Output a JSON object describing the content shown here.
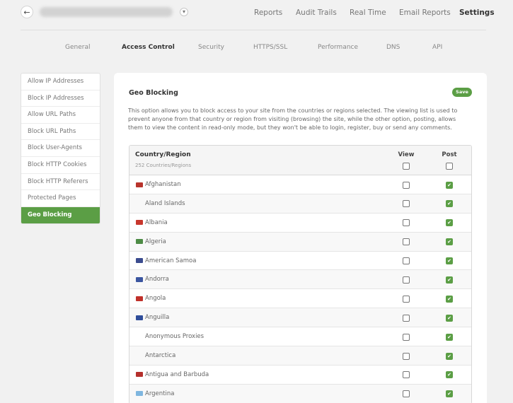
{
  "header": {
    "back_icon": "arrow-left-icon",
    "nav": [
      "Reports",
      "Audit Trails",
      "Real Time",
      "Email Reports",
      "Settings"
    ],
    "active_nav": "Settings"
  },
  "subnav": {
    "tabs": [
      "General",
      "Access Control",
      "Security",
      "HTTPS/SSL",
      "Performance",
      "DNS",
      "API"
    ],
    "active": "Access Control"
  },
  "sidebar": {
    "items": [
      "Allow IP Addresses",
      "Block IP Addresses",
      "Allow URL Paths",
      "Block URL Paths",
      "Block User-Agents",
      "Block HTTP Cookies",
      "Block HTTP Referers",
      "Protected Pages",
      "Geo Blocking"
    ],
    "active": "Geo Blocking"
  },
  "main": {
    "title": "Geo Blocking",
    "save_label": "Save",
    "description": "This option allows you to block access to your site from the countries or regions selected. The viewing list is used to prevent anyone from that country or region from visiting (browsing) the site, while the other option, posting, allows them to view the content in read-only mode, but they won't be able to login, register, buy or send any comments.",
    "table": {
      "column_country": "Country/Region",
      "count_label": "252 Countries/Regions",
      "column_view": "View",
      "column_post": "Post",
      "rows": [
        {
          "name": "Afghanistan",
          "flag": "#b8342c",
          "view": false,
          "post": true
        },
        {
          "name": "Aland Islands",
          "flag": "",
          "view": false,
          "post": true
        },
        {
          "name": "Albania",
          "flag": "#c8372d",
          "view": false,
          "post": true
        },
        {
          "name": "Algeria",
          "flag": "#4d8b45",
          "view": false,
          "post": true
        },
        {
          "name": "American Samoa",
          "flag": "#3b4c8f",
          "view": false,
          "post": true
        },
        {
          "name": "Andorra",
          "flag": "#3a55a0",
          "view": false,
          "post": true
        },
        {
          "name": "Angola",
          "flag": "#c0302a",
          "view": false,
          "post": true
        },
        {
          "name": "Anguilla",
          "flag": "#2f4d9a",
          "view": false,
          "post": true
        },
        {
          "name": "Anonymous Proxies",
          "flag": "",
          "view": false,
          "post": true
        },
        {
          "name": "Antarctica",
          "flag": "",
          "view": false,
          "post": true
        },
        {
          "name": "Antigua and Barbuda",
          "flag": "#b5302c",
          "view": false,
          "post": true
        },
        {
          "name": "Argentina",
          "flag": "#7fb6df",
          "view": false,
          "post": true
        }
      ]
    }
  },
  "colors": {
    "accent": "#5b9e45",
    "background": "#f1f1f1"
  }
}
